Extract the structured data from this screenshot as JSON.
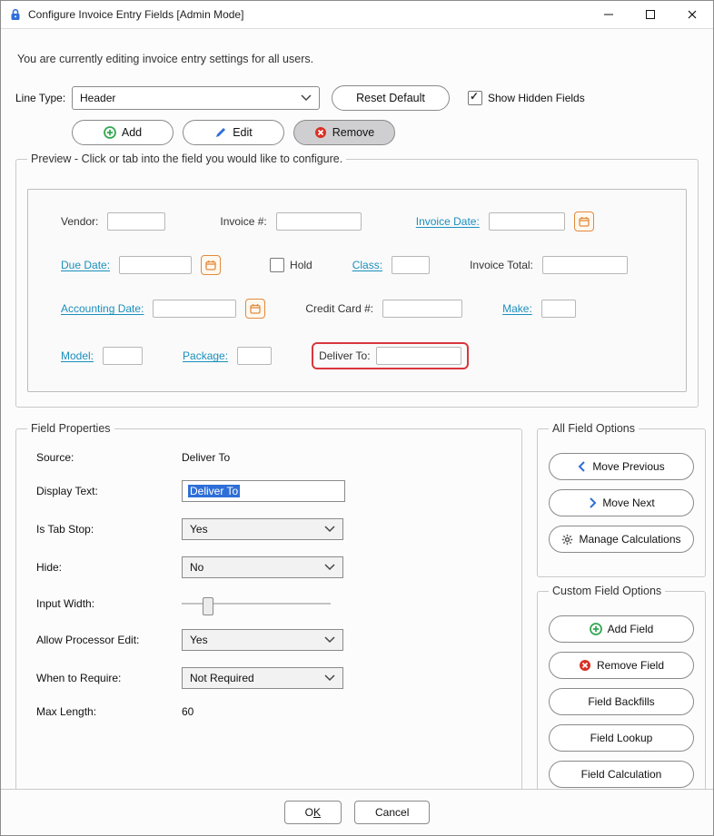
{
  "title": "Configure Invoice Entry Fields [Admin Mode]",
  "info_text": "You are currently editing invoice entry settings for all users.",
  "line_type": {
    "label": "Line Type:",
    "value": "Header"
  },
  "reset_button": "Reset Default",
  "show_hidden": {
    "label": "Show Hidden Fields",
    "checked": true
  },
  "actions": {
    "add": "Add",
    "edit": "Edit",
    "remove": "Remove"
  },
  "preview": {
    "legend": "Preview - Click or tab into the field you would like to configure.",
    "fields": {
      "vendor": "Vendor:",
      "invoice_num": "Invoice #:",
      "invoice_date": "Invoice Date:",
      "due_date": "Due Date:",
      "hold": "Hold",
      "class": "Class:",
      "invoice_total": "Invoice Total:",
      "accounting_date": "Accounting Date:",
      "credit_card_num": "Credit Card #:",
      "make": "Make:",
      "model": "Model:",
      "package": "Package:",
      "deliver_to": "Deliver To:"
    }
  },
  "field_properties": {
    "legend": "Field Properties",
    "source_label": "Source:",
    "source_value": "Deliver To",
    "display_text_label": "Display Text:",
    "display_text_value": "Deliver To",
    "is_tab_stop_label": "Is Tab Stop:",
    "is_tab_stop_value": "Yes",
    "hide_label": "Hide:",
    "hide_value": "No",
    "input_width_label": "Input Width:",
    "input_width_percent": 14,
    "allow_processor_label": "Allow Processor Edit:",
    "allow_processor_value": "Yes",
    "when_require_label": "When to Require:",
    "when_require_value": "Not Required",
    "max_length_label": "Max Length:",
    "max_length_value": "60"
  },
  "all_field_options": {
    "legend": "All Field Options",
    "move_previous": "Move Previous",
    "move_next": "Move Next",
    "manage_calculations": "Manage Calculations"
  },
  "custom_field_options": {
    "legend": "Custom Field Options",
    "add_field": "Add Field",
    "remove_field": "Remove Field",
    "field_backfills": "Field Backfills",
    "field_lookup": "Field Lookup",
    "field_calculation": "Field Calculation"
  },
  "footer": {
    "ok_prefix": "O",
    "ok_mn": "K",
    "cancel": "Cancel"
  },
  "colors": {
    "link": "#1b8fbd",
    "selected_border": "#d9363e",
    "green": "#34a853",
    "red": "#d93025",
    "blue": "#2e6fd7",
    "orange": "#e18a3d"
  }
}
